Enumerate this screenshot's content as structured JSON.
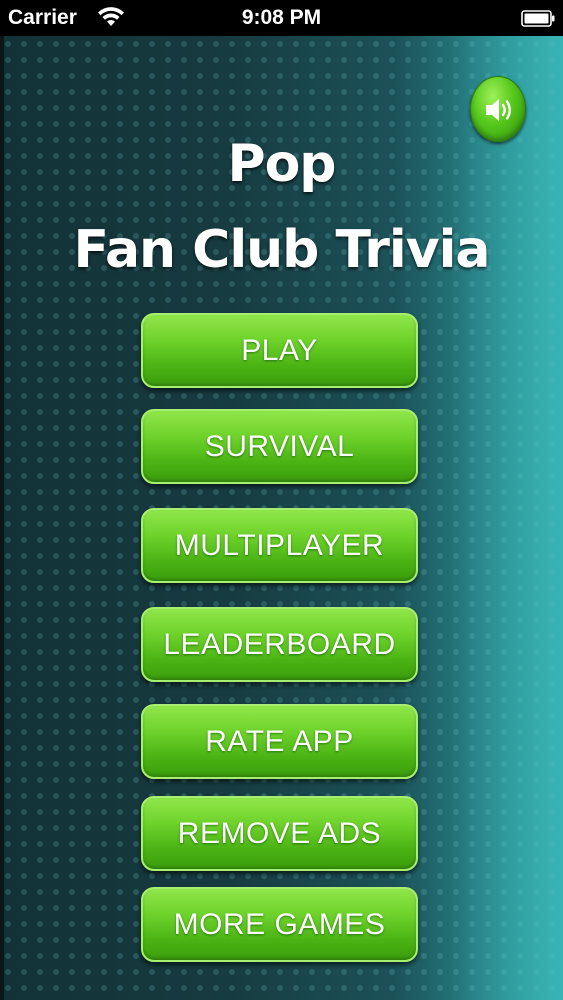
{
  "status_bar": {
    "carrier": "Carrier",
    "time": "9:08 PM",
    "wifi_icon": "wifi-icon",
    "battery_icon": "battery-icon"
  },
  "app": {
    "title_line1": "Pop",
    "title_line2": "Fan Club Trivia",
    "sound_icon": "speaker-icon",
    "accent_color": "#5cc51f"
  },
  "menu": {
    "play": "PLAY",
    "survival": "SURVIVAL",
    "multiplayer": "MULTIPLAYER",
    "leaderboard": "LEADERBOARD",
    "rate_app": "RATE APP",
    "remove_ads": "REMOVE ADS",
    "more_games": "MORE GAMES"
  }
}
